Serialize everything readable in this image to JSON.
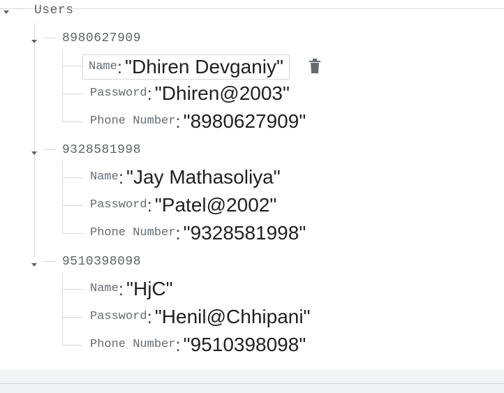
{
  "root": {
    "key": "Users"
  },
  "users": [
    {
      "key": "8980627909",
      "fields": [
        {
          "name": "Name",
          "value": "\"Dhiren Devganiy\""
        },
        {
          "name": "Password",
          "value": "\"Dhiren@2003\""
        },
        {
          "name": "Phone Number",
          "value": "\"8980627909\""
        }
      ]
    },
    {
      "key": "9328581998",
      "fields": [
        {
          "name": "Name",
          "value": "\"Jay Mathasoliya\""
        },
        {
          "name": "Password",
          "value": "\"Patel@2002\""
        },
        {
          "name": "Phone Number",
          "value": "\"9328581998\""
        }
      ]
    },
    {
      "key": "9510398098",
      "fields": [
        {
          "name": "Name",
          "value": "\"HjC\""
        },
        {
          "name": "Password",
          "value": "\"Henil@Chhipani\""
        },
        {
          "name": "Phone Number",
          "value": "\"9510398098\""
        }
      ]
    }
  ],
  "icons": {
    "caret": "caret-down-icon",
    "delete": "trash-icon"
  },
  "colors": {
    "line": "#d7d7d7",
    "key_text": "#5f6368",
    "value_text": "#202124"
  }
}
